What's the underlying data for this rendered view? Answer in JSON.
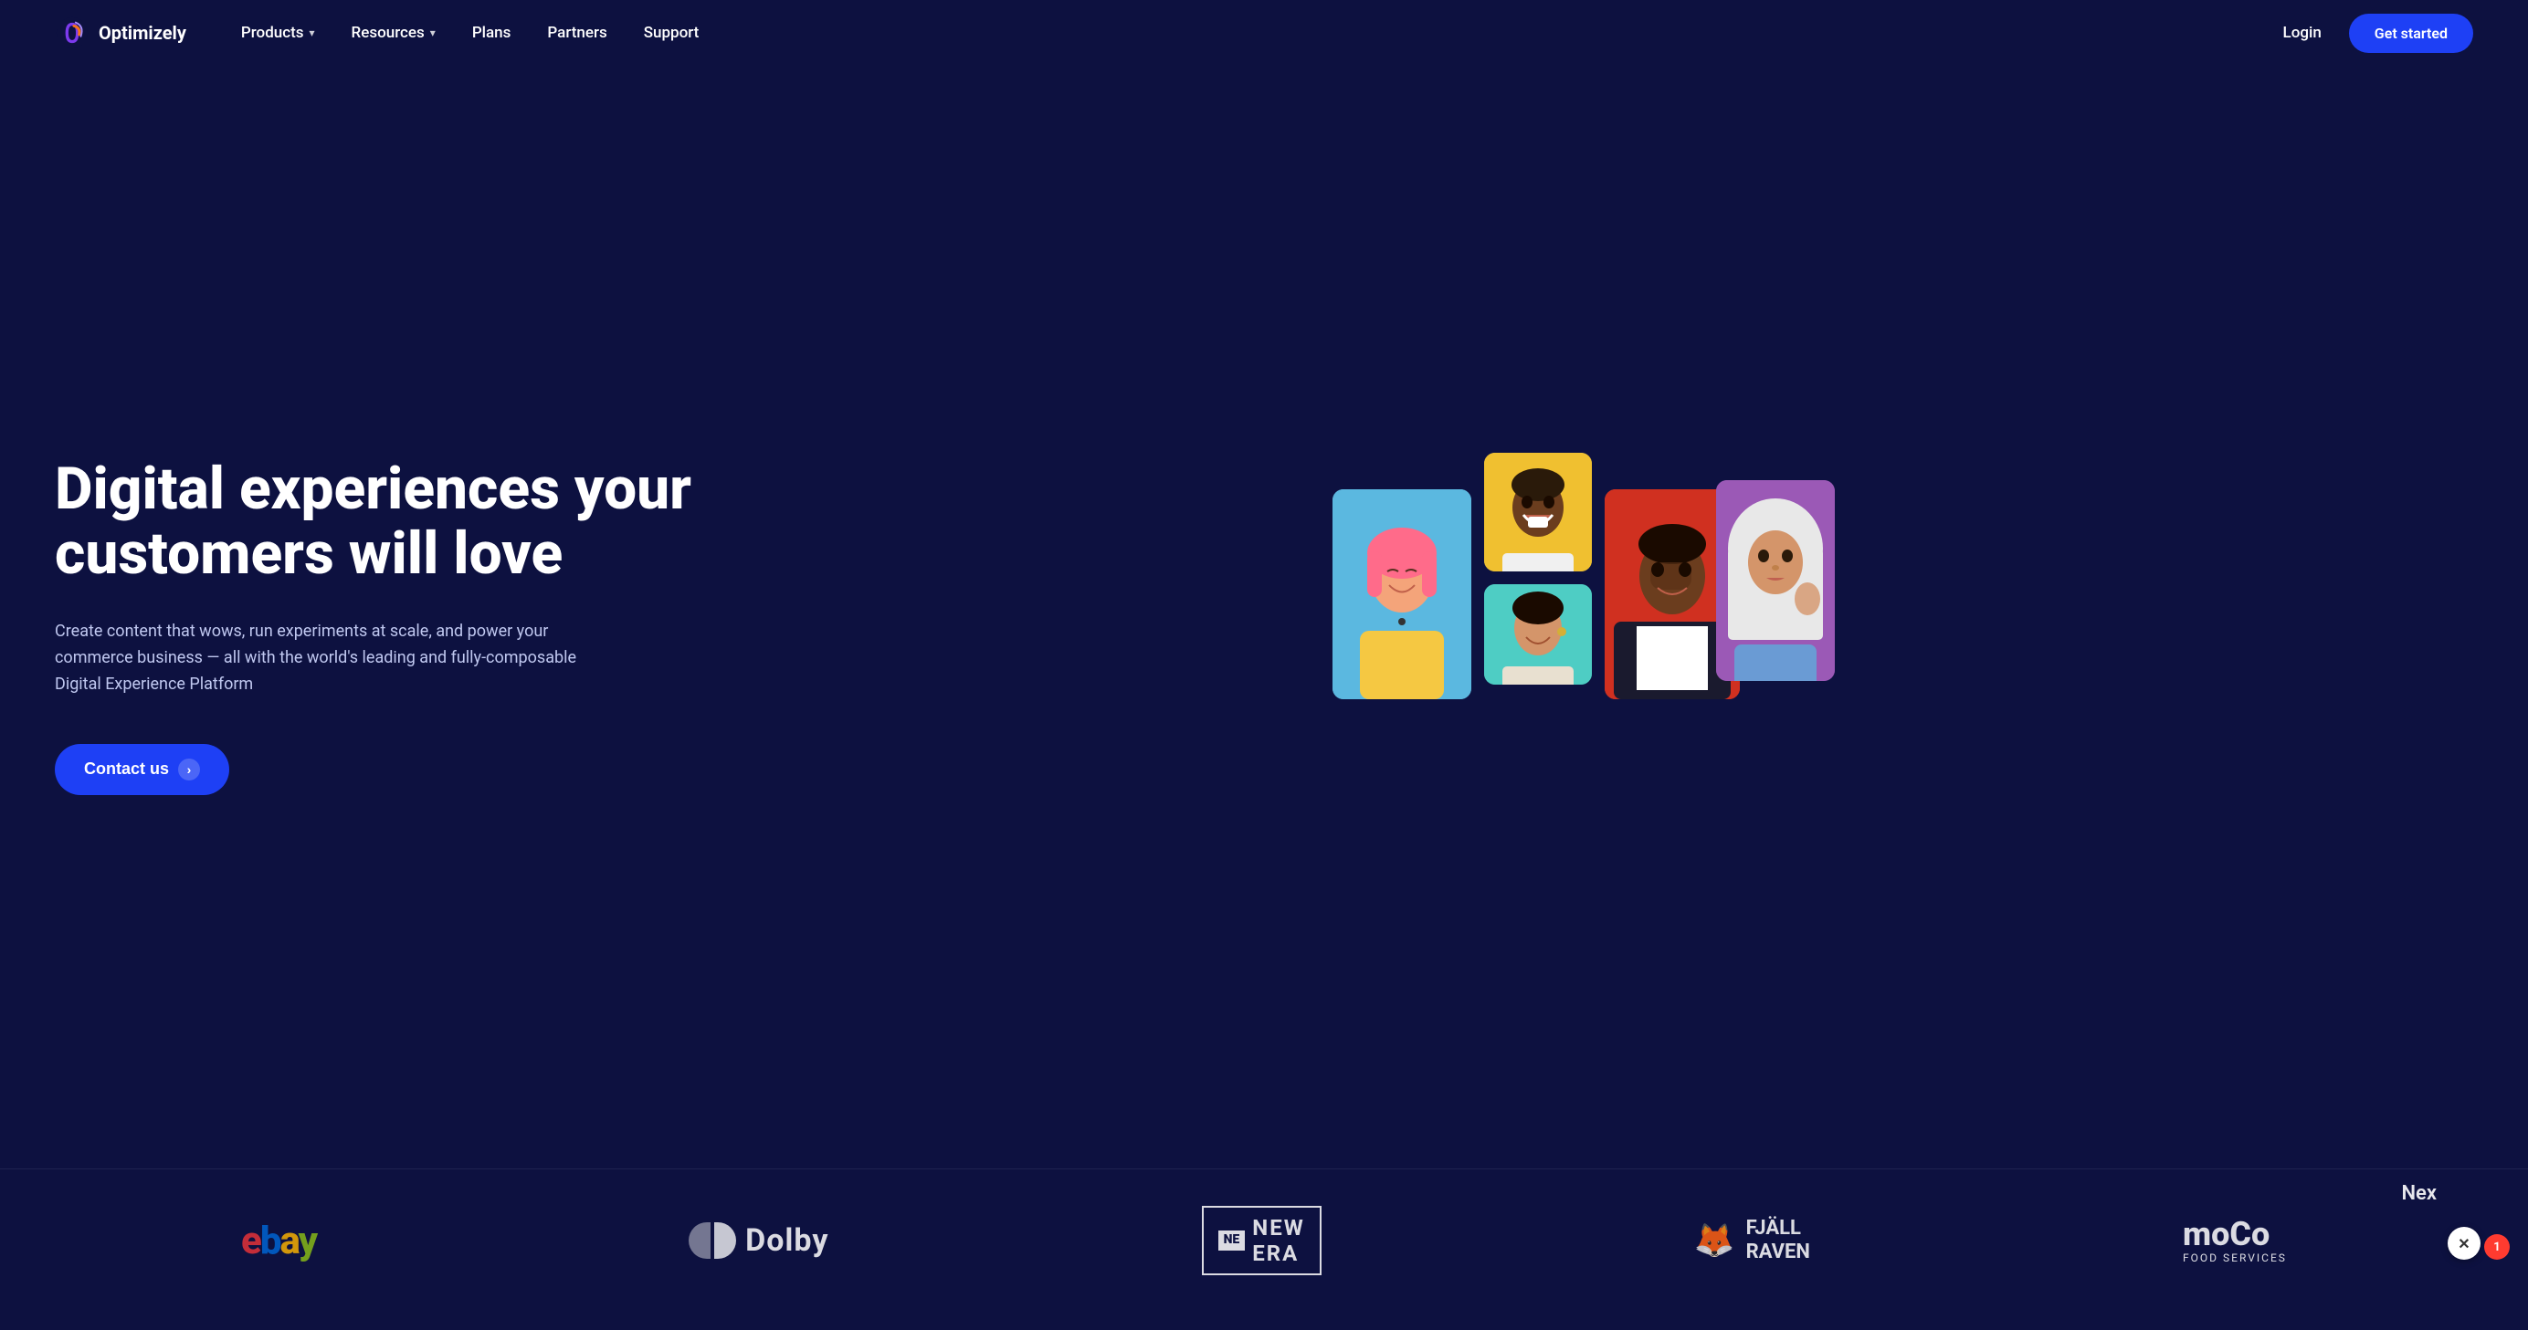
{
  "brand": {
    "name": "Optimizely",
    "logo_alt": "Optimizely logo"
  },
  "nav": {
    "products_label": "Products",
    "resources_label": "Resources",
    "plans_label": "Plans",
    "partners_label": "Partners",
    "support_label": "Support",
    "login_label": "Login",
    "get_started_label": "Get started"
  },
  "hero": {
    "title": "Digital experiences your customers will love",
    "description": "Create content that wows, run experiments at scale, and power your commerce business — all with the world's leading and fully-composable Digital Experience Platform",
    "cta_label": "Contact us"
  },
  "logos": {
    "ebay": "ebay",
    "dolby": "Dolby",
    "new_era": "NEW ERA",
    "new_era_flag": "NE",
    "fjallraven": "FJÄLL\nRAVEN",
    "moco": "moCo",
    "moco_sub": "FOOD SERVICES"
  },
  "notification": {
    "count": "1"
  },
  "nex_text": "Nex"
}
